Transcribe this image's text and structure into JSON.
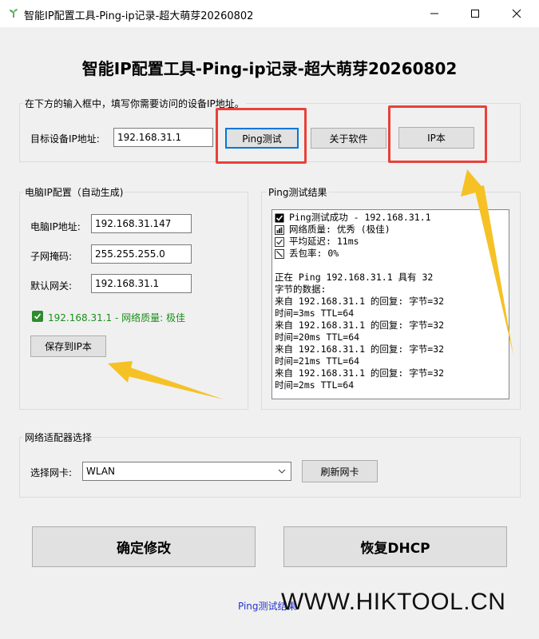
{
  "window": {
    "title": "智能IP配置工具-Ping-ip记录-超大萌芽20260802",
    "icon": "sprout-icon",
    "controls": [
      "minimize-icon",
      "maximize-icon",
      "close-icon"
    ]
  },
  "heading": "智能IP配置工具-Ping-ip记录-超大萌芽20260802",
  "target_group": {
    "label": "在下方的输入框中，填写你需要访问的设备IP地址。",
    "ip_label": "目标设备IP地址:",
    "ip_value": "192.168.31.1",
    "ping_button": "Ping测试",
    "about_button": "关于软件",
    "ipbook_button": "IP本"
  },
  "pc_group": {
    "label": "电脑IP配置（自动生成)",
    "ip_label": "电脑IP地址:",
    "ip_value": "192.168.31.147",
    "mask_label": "子网掩码:",
    "mask_value": "255.255.255.0",
    "gateway_label": "默认网关:",
    "gateway_value": "192.168.31.1",
    "status_text": "192.168.31.1 - 网络质量: 极佳",
    "save_button": "保存到IP本"
  },
  "ping_group": {
    "label": "Ping测试结果",
    "lines": [
      {
        "icon": "check-box-icon",
        "text": "Ping测试成功 - 192.168.31.1"
      },
      {
        "icon": "bar-chart-icon",
        "text": "网络质量: 优秀 (极佳)"
      },
      {
        "icon": "check-small-icon",
        "text": "平均延迟: 11ms"
      },
      {
        "icon": "no-entry-icon",
        "text": "丢包率: 0%"
      },
      {
        "icon": "",
        "text": ""
      },
      {
        "icon": "",
        "text": "正在 Ping 192.168.31.1 具有 32"
      },
      {
        "icon": "",
        "text": "字节的数据:"
      },
      {
        "icon": "",
        "text": "来自 192.168.31.1 的回复: 字节=32"
      },
      {
        "icon": "",
        "text": "时间=3ms TTL=64"
      },
      {
        "icon": "",
        "text": "来自 192.168.31.1 的回复: 字节=32"
      },
      {
        "icon": "",
        "text": "时间=20ms TTL=64"
      },
      {
        "icon": "",
        "text": "来自 192.168.31.1 的回复: 字节=32"
      },
      {
        "icon": "",
        "text": "时间=21ms TTL=64"
      },
      {
        "icon": "",
        "text": "来自 192.168.31.1 的回复: 字节=32"
      },
      {
        "icon": "",
        "text": "时间=2ms TTL=64"
      }
    ]
  },
  "adapter_group": {
    "label": "网络适配器选择",
    "select_label": "选择网卡:",
    "selected": "WLAN",
    "refresh_button": "刷新网卡"
  },
  "actions": {
    "confirm_button": "确定修改",
    "dhcp_button": "恢复DHCP"
  },
  "footer": {
    "link_text": "Ping测试结果",
    "watermark": "WWW.HIKTOOL.CN"
  },
  "colors": {
    "highlight": "#e8413a",
    "arrow": "#f5c125",
    "status_green": "#1a8f1a",
    "link_blue": "#2233cc"
  }
}
